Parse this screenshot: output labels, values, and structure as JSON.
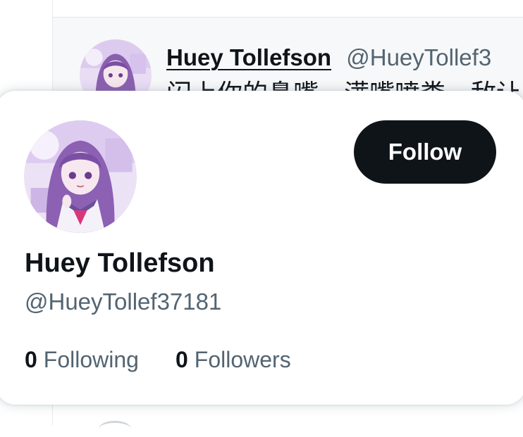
{
  "timeline_tweet": {
    "author_name": "Huey Tollefson",
    "author_handle": "@HueyTollef3",
    "text": "闪上你的鼻嘴，满嘴喷粪，敌让"
  },
  "hover_card": {
    "name": "Huey Tollefson",
    "handle": "@HueyTollef37181",
    "follow_label": "Follow",
    "following_count": "0",
    "following_label": "Following",
    "followers_count": "0",
    "followers_label": "Followers"
  },
  "icons": {
    "tweet_avatar": "anime-avatar-image",
    "card_avatar": "anime-avatar-image"
  },
  "colors": {
    "primary_text": "#0f1419",
    "secondary_text": "#536471",
    "follow_button_bg": "#0f1419",
    "follow_button_text": "#ffffff",
    "avatar_accent": "#c9a8e6"
  }
}
